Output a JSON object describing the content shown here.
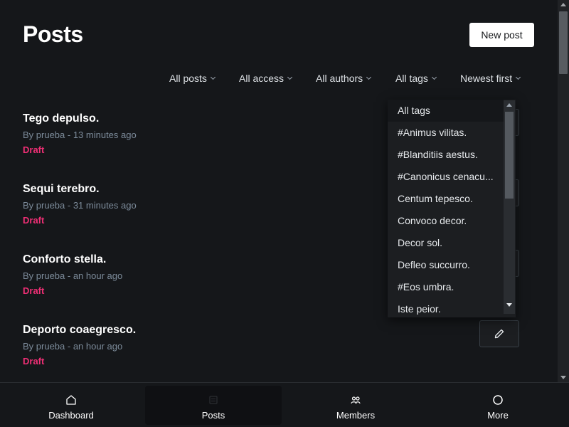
{
  "header": {
    "title": "Posts",
    "new_post_label": "New post"
  },
  "filters": [
    {
      "label": "All posts"
    },
    {
      "label": "All access"
    },
    {
      "label": "All authors"
    },
    {
      "label": "All tags"
    },
    {
      "label": "Newest first"
    }
  ],
  "posts": [
    {
      "title": "Tego depulso.",
      "meta": "By prueba - 13 minutes ago",
      "status": "Draft"
    },
    {
      "title": "Sequi terebro.",
      "meta": "By prueba - 31 minutes ago",
      "status": "Draft"
    },
    {
      "title": "Conforto stella.",
      "meta": "By prueba - an hour ago",
      "status": "Draft"
    },
    {
      "title": "Deporto coaegresco.",
      "meta": "By prueba - an hour ago",
      "status": "Draft"
    }
  ],
  "tags_dropdown": {
    "selected": "All tags",
    "options": [
      "All tags",
      "#Animus vilitas.",
      "#Blanditiis aestus.",
      "#Canonicus cenacu...",
      "Centum tepesco.",
      "Convoco decor.",
      "Decor sol.",
      "Defleo succurro.",
      "#Eos umbra.",
      "Iste peior."
    ]
  },
  "bottom_nav": [
    {
      "label": "Dashboard",
      "icon": "home-icon"
    },
    {
      "label": "Posts",
      "icon": "posts-icon",
      "active": true
    },
    {
      "label": "Members",
      "icon": "members-icon"
    },
    {
      "label": "More",
      "icon": "more-icon"
    }
  ],
  "colors": {
    "background": "#15171a",
    "draft": "#ef2f75",
    "text": "#ffffff",
    "muted": "#7c8b9a"
  }
}
